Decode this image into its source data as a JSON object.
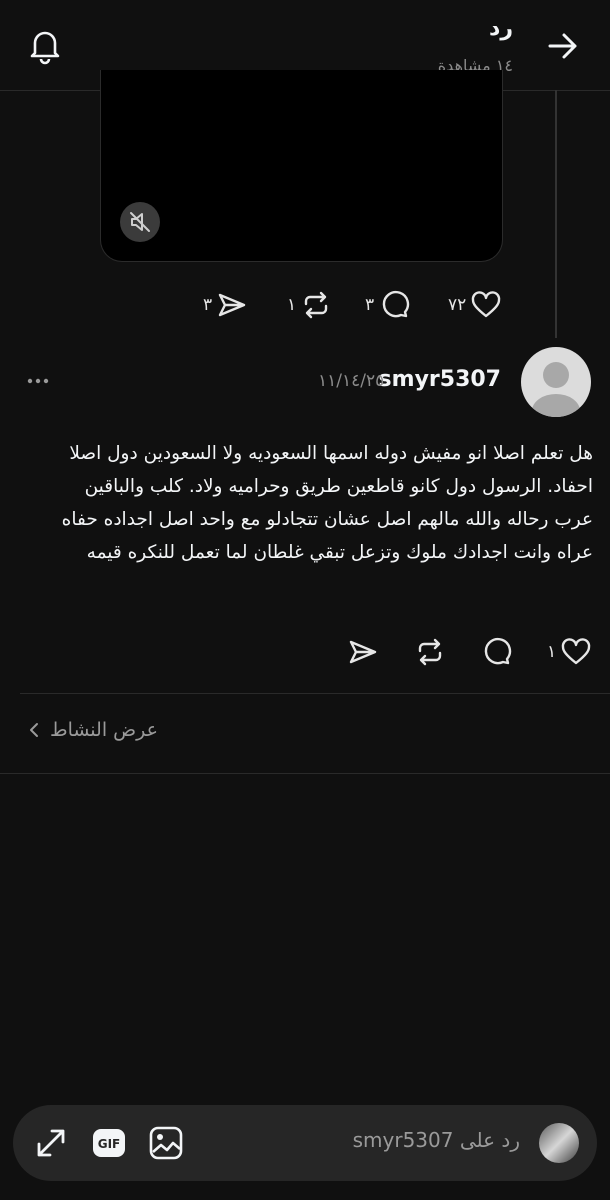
{
  "header": {
    "title": "رد",
    "views": "١٤ مشاهدة",
    "icons": {
      "back": "arrow-right-icon",
      "notifications": "bell-icon"
    }
  },
  "parent_post": {
    "actions": {
      "likes": "٧٢",
      "comments": "٣",
      "reposts": "١",
      "shares": "٣"
    }
  },
  "reply": {
    "username": "smyr5307",
    "timestamp": "١١/١٤/٢٥",
    "body": "هل تعلم اصلا انو مفيش دوله اسمها السعوديه ولا السعودين دول اصلا احفاد. الرسول دول كانو قاطعين طريق وحراميه ولاد. كلب والباقين عرب رحاله  والله مالهم اصل عشان تتجادلو مع واحد اصل اجداده حفاه عراه وانت اجدادك ملوك وتزعل تبقي غلطان لما تعمل للنكره قيمه",
    "actions": {
      "likes": "١"
    }
  },
  "activity_link": "عرض النشاط",
  "composer": {
    "placeholder": "رد على smyr5307"
  }
}
